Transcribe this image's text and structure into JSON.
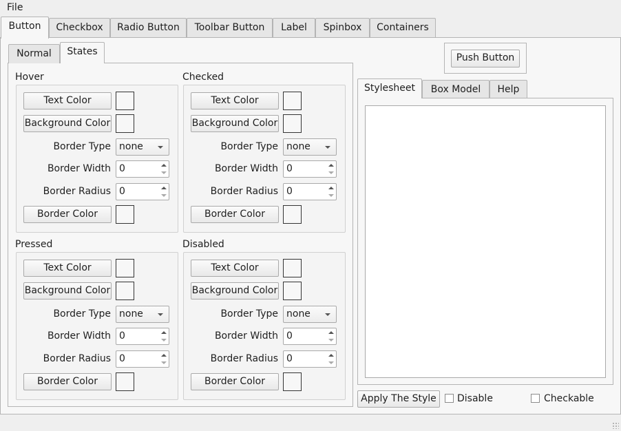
{
  "menu": {
    "file": "File"
  },
  "main_tabs": [
    "Button",
    "Checkbox",
    "Radio Button",
    "Toolbar Button",
    "Label",
    "Spinbox",
    "Containers"
  ],
  "sub_tabs": [
    "Normal",
    "States"
  ],
  "groups": {
    "hover": {
      "title": "Hover",
      "text_color": "Text Color",
      "background_color": "Background Color",
      "border_type_label": "Border Type",
      "border_type_value": "none",
      "border_width_label": "Border Width",
      "border_width_value": "0",
      "border_radius_label": "Border Radius",
      "border_radius_value": "0",
      "border_color": "Border Color"
    },
    "checked": {
      "title": "Checked",
      "text_color": "Text Color",
      "background_color": "Background Color",
      "border_type_label": "Border Type",
      "border_type_value": "none",
      "border_width_label": "Border Width",
      "border_width_value": "0",
      "border_radius_label": "Border Radius",
      "border_radius_value": "0",
      "border_color": "Border Color"
    },
    "pressed": {
      "title": "Pressed",
      "text_color": "Text Color",
      "background_color": "Background Color",
      "border_type_label": "Border Type",
      "border_type_value": "none",
      "border_width_label": "Border Width",
      "border_width_value": "0",
      "border_radius_label": "Border Radius",
      "border_radius_value": "0",
      "border_color": "Border Color"
    },
    "disabled": {
      "title": "Disabled",
      "text_color": "Text Color",
      "background_color": "Background Color",
      "border_type_label": "Border Type",
      "border_type_value": "none",
      "border_width_label": "Border Width",
      "border_width_value": "0",
      "border_radius_label": "Border Radius",
      "border_radius_value": "0",
      "border_color": "Border Color"
    }
  },
  "preview": {
    "push_button": "Push Button"
  },
  "right_tabs": [
    "Stylesheet",
    "Box Model",
    "Help"
  ],
  "stylesheet_text": "",
  "footer": {
    "apply": "Apply The Style",
    "disable": "Disable",
    "checkable": "Checkable"
  }
}
